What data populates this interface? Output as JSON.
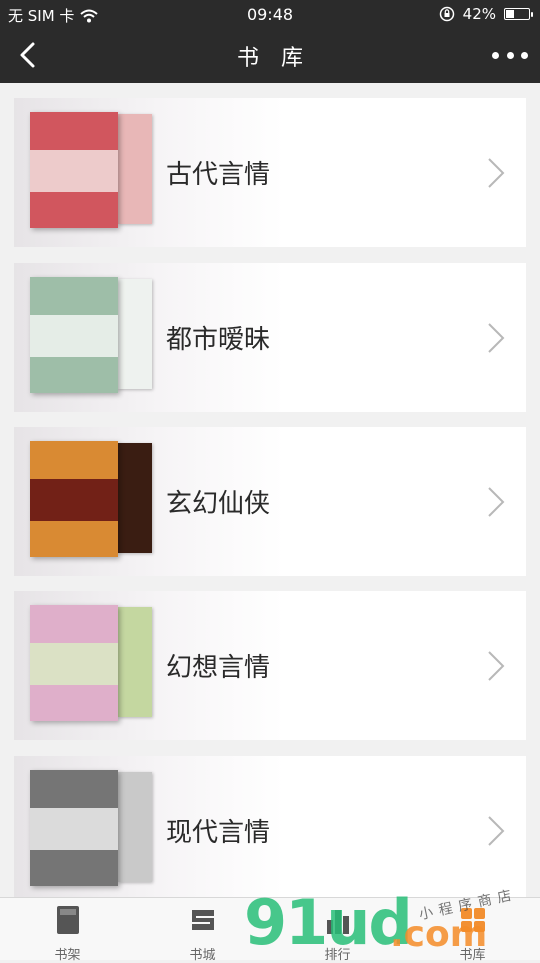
{
  "status_bar": {
    "carrier": "无 SIM 卡",
    "time": "09:48",
    "battery_percent": "42%",
    "battery_level": 0.42
  },
  "nav": {
    "title": "书库",
    "back_icon": "chevron-left-icon",
    "more_icon": "more-dots-icon"
  },
  "categories": [
    {
      "label": "古代言情",
      "cover_colors": [
        "#f3e4e4",
        "#c8323c",
        "#e8b7b7"
      ]
    },
    {
      "label": "都市暧昧",
      "cover_colors": [
        "#d9e6de",
        "#8fb49a",
        "#eef2ef"
      ]
    },
    {
      "label": "玄幻仙侠",
      "cover_colors": [
        "#b6261d",
        "#e2a43a",
        "#3a1d12"
      ]
    },
    {
      "label": "幻想言情",
      "cover_colors": [
        "#f5eef2",
        "#d99fbf",
        "#c4d7a0"
      ]
    },
    {
      "label": "现代言情",
      "cover_colors": [
        "#f2f2f2",
        "#555555",
        "#c9c9c9"
      ]
    }
  ],
  "tabs": [
    {
      "label": "书架",
      "icon": "bookshelf-icon"
    },
    {
      "label": "书城",
      "icon": "bookstore-icon"
    },
    {
      "label": "排行",
      "icon": "ranking-icon"
    },
    {
      "label": "书库",
      "icon": "library-icon"
    }
  ],
  "watermark": {
    "main": "91ud",
    "suffix": ".com",
    "tagline": "小程序商店"
  },
  "colors": {
    "header_bg": "#2b2b2b",
    "page_bg": "#f1f1f1",
    "card_bg": "#ffffff"
  }
}
